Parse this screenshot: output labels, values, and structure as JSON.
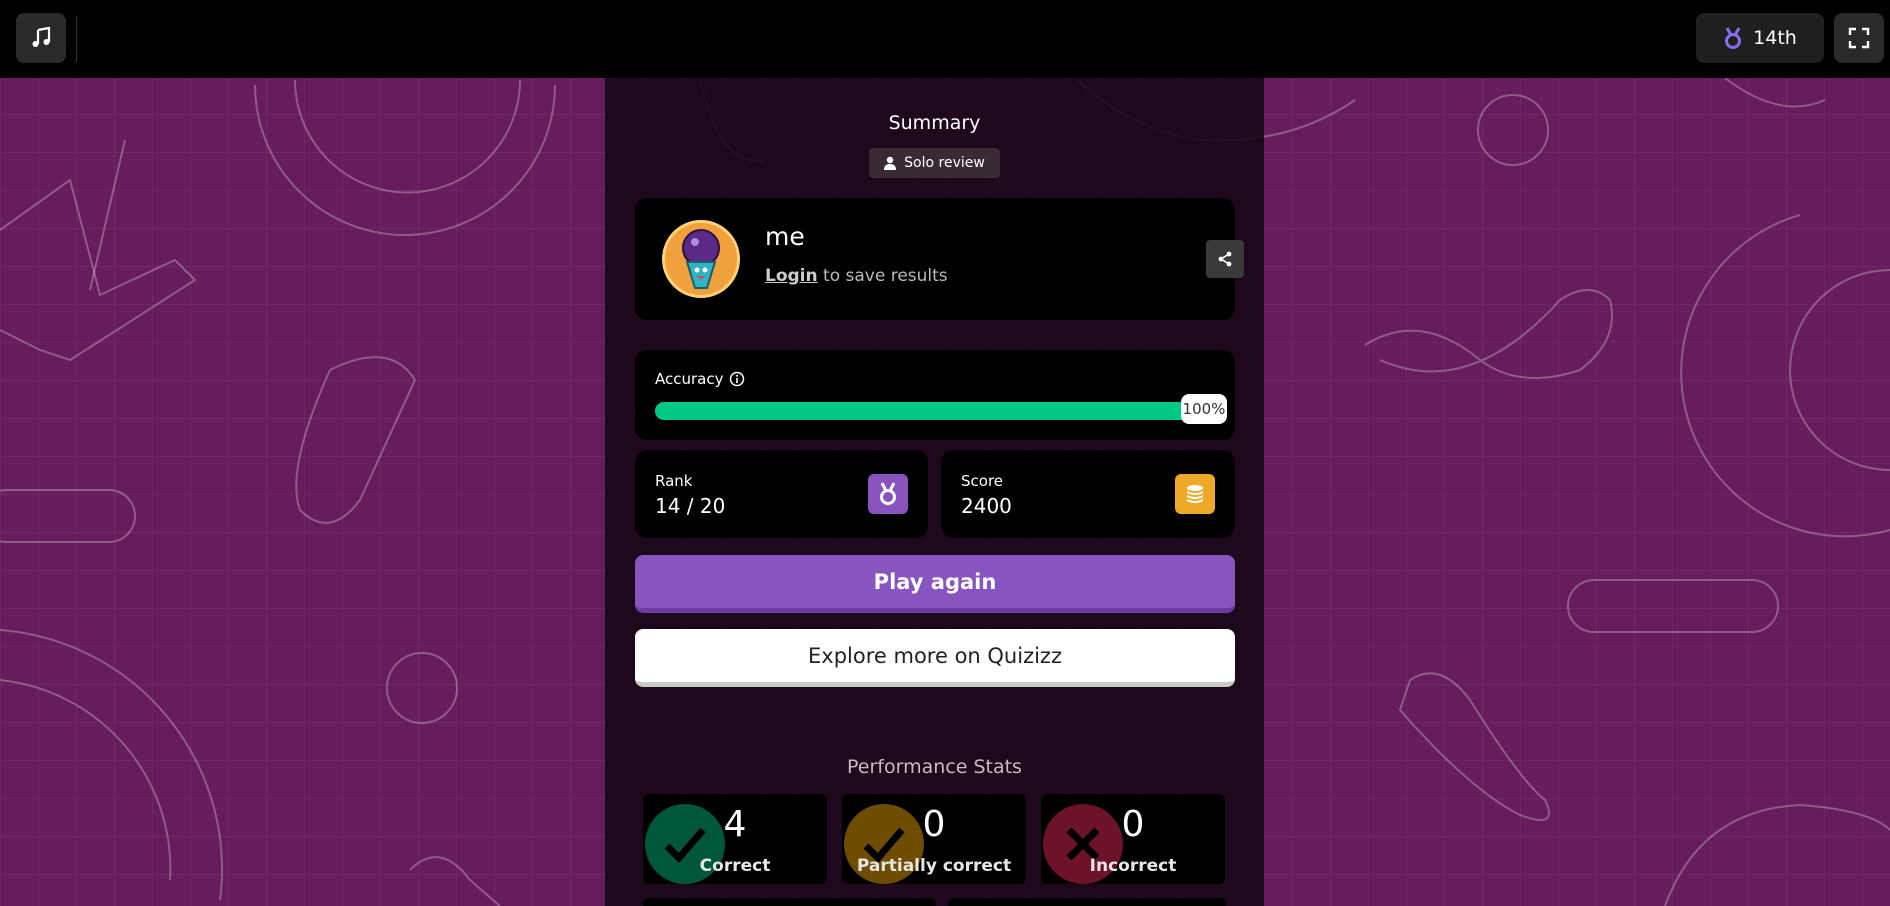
{
  "topbar": {
    "music_icon": "music-note-icon",
    "rank_badge": "14th",
    "rank_icon": "medal-icon",
    "fullscreen_icon": "fullscreen-icon"
  },
  "summary": {
    "title": "Summary",
    "mode_tag": "Solo review"
  },
  "profile": {
    "name": "me",
    "login_link": "Login",
    "login_suffix": " to save results"
  },
  "accuracy": {
    "label": "Accuracy",
    "value_label": "100%",
    "value": 1.0,
    "color": "#00c985"
  },
  "rank": {
    "label": "Rank",
    "value": "14 / 20",
    "icon_color": "#8854c0"
  },
  "score": {
    "label": "Score",
    "value": "2400",
    "icon_color": "#efa929"
  },
  "buttons": {
    "play_again": "Play again",
    "explore": "Explore more on Quizizz"
  },
  "performance": {
    "title": "Performance Stats",
    "stats": [
      {
        "value": "4",
        "label": "Correct",
        "color": "#00a06a"
      },
      {
        "value": "0",
        "label": "Partially correct",
        "color": "#c98a00"
      },
      {
        "value": "0",
        "label": "Incorrect",
        "color": "#c5234b"
      }
    ]
  },
  "colors": {
    "background": "#661c5d",
    "accent": "#8854c0"
  }
}
